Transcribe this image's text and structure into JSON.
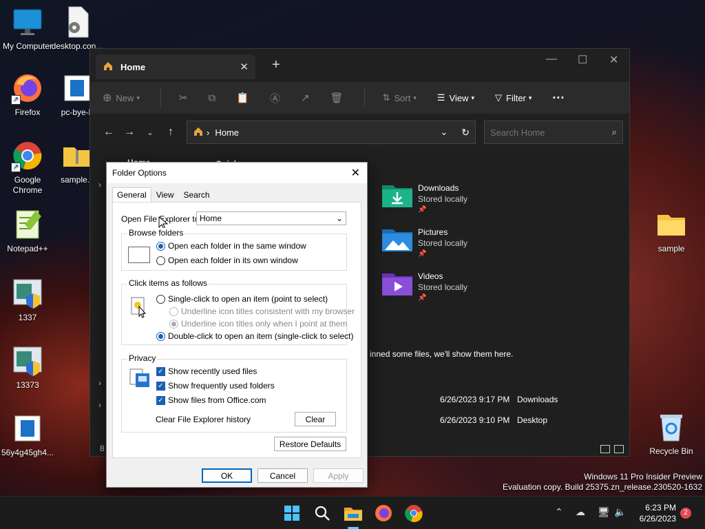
{
  "desktop": {
    "icons": [
      {
        "label": "My Computer",
        "icon": "monitor-icon"
      },
      {
        "label": "desktop.con...",
        "icon": "settings-file-icon"
      },
      {
        "label": "Firefox",
        "icon": "firefox-icon"
      },
      {
        "label": "pc-bye-b",
        "icon": "document-icon"
      },
      {
        "label": "Google Chrome",
        "icon": "chrome-icon"
      },
      {
        "label": "sample.c",
        "icon": "zip-folder-icon"
      },
      {
        "label": "Notepad++",
        "icon": "notepad-plus-icon"
      },
      {
        "label": "1337",
        "icon": "program-icon"
      },
      {
        "label": "13373",
        "icon": "program-icon"
      },
      {
        "label": "56y4g45gh4...",
        "icon": "document-icon"
      },
      {
        "label": "sample",
        "icon": "folder-icon"
      },
      {
        "label": "Recycle Bin",
        "icon": "recycle-bin-icon"
      }
    ]
  },
  "explorer": {
    "tab_title": "Home",
    "toolbar": {
      "new": "New",
      "sort": "Sort",
      "view": "View",
      "filter": "Filter"
    },
    "address": "Home",
    "search_placeholder": "Search Home",
    "sidebar_partial": "Home",
    "main_partial": "Quick",
    "quick_access": [
      {
        "name": "Downloads",
        "status": "Stored locally",
        "color": "#1db48a"
      },
      {
        "name": "Pictures",
        "status": "Stored locally",
        "color": "#2a8de0"
      },
      {
        "name": "Videos",
        "status": "Stored locally",
        "color": "#8a4fd8"
      }
    ],
    "recent_message": "inned some files, we'll show them here.",
    "recent": [
      {
        "date": "6/26/2023 9:17 PM",
        "location": "Downloads"
      },
      {
        "date": "6/26/2023 9:10 PM",
        "location": "Desktop"
      }
    ],
    "status_partial": "8"
  },
  "dialog": {
    "title": "Folder Options",
    "tabs": [
      "General",
      "View",
      "Search"
    ],
    "open_explorer_label": "Open File Explorer to:",
    "open_explorer_value": "Home",
    "browse": {
      "title": "Browse folders",
      "same_window": "Open each folder in the same window",
      "own_window": "Open each folder in its own window"
    },
    "click": {
      "title": "Click items as follows",
      "single": "Single-click to open an item (point to select)",
      "underline_browser": "Underline icon titles consistent with my browser",
      "underline_point": "Underline icon titles only when I point at them",
      "double": "Double-click to open an item (single-click to select)"
    },
    "privacy": {
      "title": "Privacy",
      "recent_files": "Show recently used files",
      "frequent_folders": "Show frequently used folders",
      "office_files": "Show files from Office.com",
      "clear_label": "Clear File Explorer history",
      "clear_button": "Clear"
    },
    "restore_defaults": "Restore Defaults",
    "ok": "OK",
    "cancel": "Cancel",
    "apply": "Apply"
  },
  "watermark": {
    "line1": "Windows 11 Pro Insider Preview",
    "line2": "Evaluation copy. Build 25375.zn_release.230520-1632"
  },
  "taskbar": {
    "time": "6:23 PM",
    "date": "6/26/2023",
    "notification_count": "2",
    "accent": "#60cdff"
  }
}
